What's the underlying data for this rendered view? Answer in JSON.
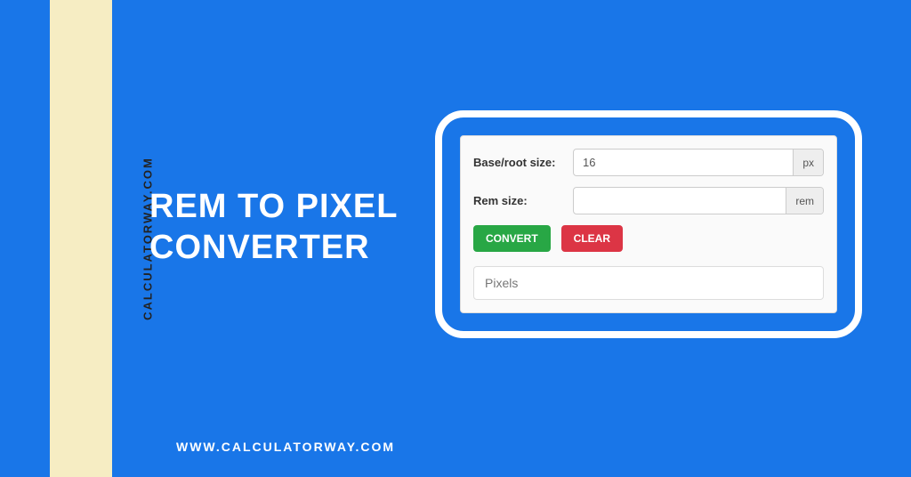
{
  "brand_vertical": "CALCULATORWAY.COM",
  "title_line1": "REM TO PIXEL",
  "title_line2": "CONVERTER",
  "footer_url": "WWW.CALCULATORWAY.COM",
  "form": {
    "base_label": "Base/root size:",
    "base_value": "16",
    "base_unit": "px",
    "rem_label": "Rem size:",
    "rem_value": "",
    "rem_unit": "rem",
    "convert_label": "CONVERT",
    "clear_label": "CLEAR",
    "output_placeholder": "Pixels"
  }
}
